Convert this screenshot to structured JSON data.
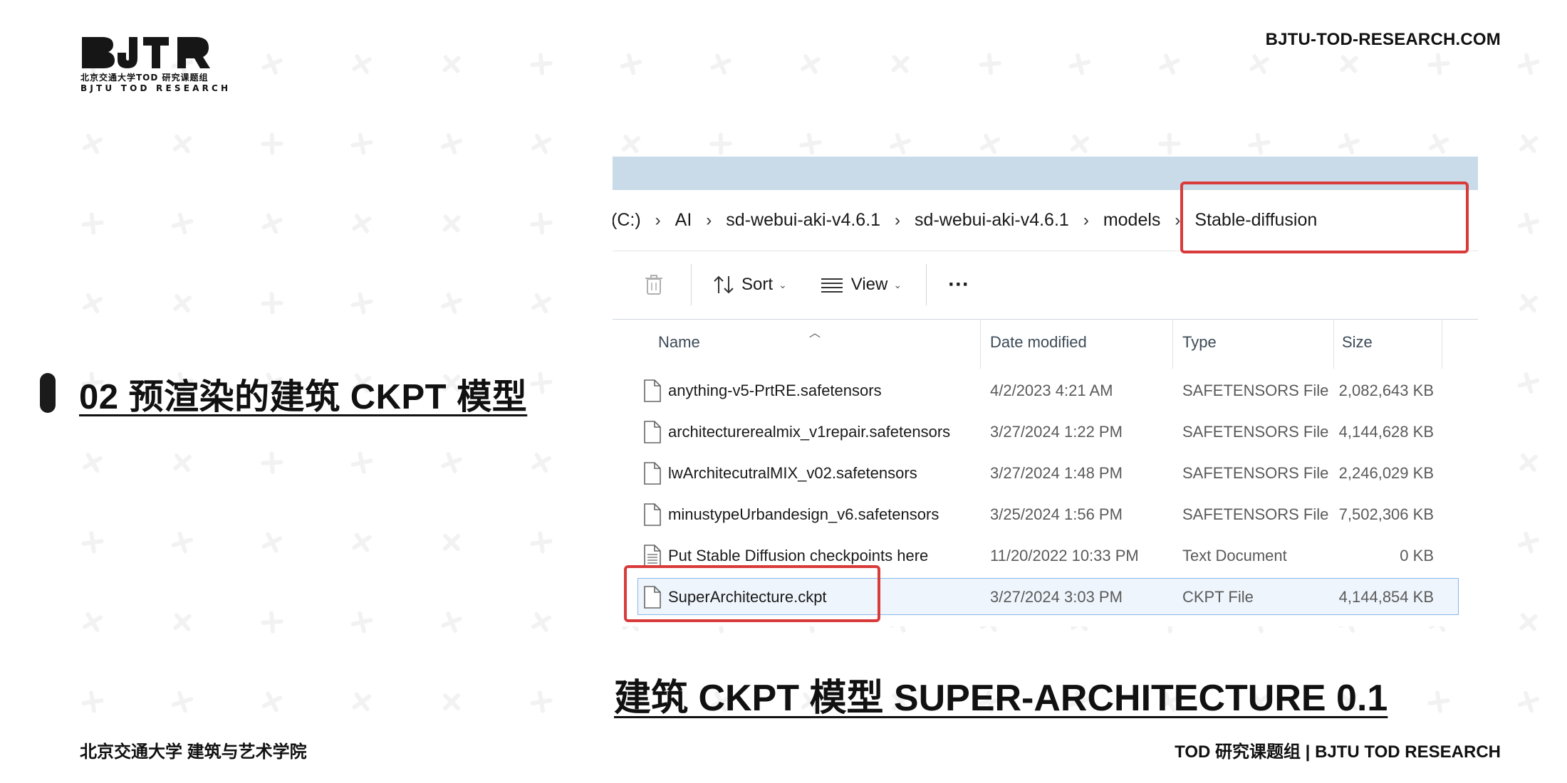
{
  "header": {
    "logo_text_cn": "北京交通大学TOD 研究课题组",
    "logo_text_en": "BJTU TOD RESEARCH",
    "site_url": "BJTU-TOD-RESEARCH.COM"
  },
  "section": {
    "title": "02 预渲染的建筑 CKPT 模型"
  },
  "explorer": {
    "breadcrumb": [
      "(C:)",
      "AI",
      "sd-webui-aki-v4.6.1",
      "sd-webui-aki-v4.6.1",
      "models",
      "Stable-diffusion"
    ],
    "toolbar": {
      "sort_label": "Sort",
      "view_label": "View",
      "more_label": "···"
    },
    "columns": {
      "name": "Name",
      "date": "Date modified",
      "type": "Type",
      "size": "Size"
    },
    "files": [
      {
        "name": "anything-v5-PrtRE.safetensors",
        "date": "4/2/2023 4:21 AM",
        "type": "SAFETENSORS File",
        "size": "2,082,643 KB",
        "icon": "file-icon"
      },
      {
        "name": "architecturerealmix_v1repair.safetensors",
        "date": "3/27/2024 1:22 PM",
        "type": "SAFETENSORS File",
        "size": "4,144,628 KB",
        "icon": "file-icon"
      },
      {
        "name": "lwArchitecutralMIX_v02.safetensors",
        "date": "3/27/2024 1:48 PM",
        "type": "SAFETENSORS File",
        "size": "2,246,029 KB",
        "icon": "file-icon"
      },
      {
        "name": "minustypeUrbandesign_v6.safetensors",
        "date": "3/25/2024 1:56 PM",
        "type": "SAFETENSORS File",
        "size": "7,502,306 KB",
        "icon": "file-icon"
      },
      {
        "name": "Put Stable Diffusion checkpoints here",
        "date": "11/20/2022 10:33 PM",
        "type": "Text Document",
        "size": "0 KB",
        "icon": "text-document-icon"
      },
      {
        "name": "SuperArchitecture.ckpt",
        "date": "3/27/2024 3:03 PM",
        "type": "CKPT File",
        "size": "4,144,854 KB",
        "icon": "file-icon",
        "selected": true
      }
    ],
    "highlight_color": "#d93a3a"
  },
  "caption": "建筑 CKPT 模型 SUPER-ARCHITECTURE 0.1",
  "footer": {
    "left": "北京交通大学 建筑与艺术学院",
    "right": "TOD 研究课题组 | BJTU TOD RESEARCH"
  }
}
